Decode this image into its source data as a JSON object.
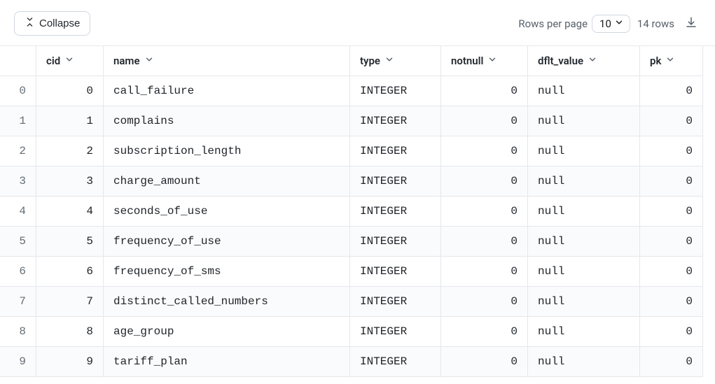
{
  "toolbar": {
    "collapse_label": "Collapse",
    "rows_per_page_label": "Rows per page",
    "rows_per_page_value": "10",
    "total_rows_label": "14 rows"
  },
  "table": {
    "headers": {
      "cid": "cid",
      "name": "name",
      "type": "type",
      "notnull": "notnull",
      "dflt_value": "dflt_value",
      "pk": "pk"
    },
    "rows": [
      {
        "idx": "0",
        "cid": "0",
        "name": "call_failure",
        "type": "INTEGER",
        "notnull": "0",
        "dflt_value": "null",
        "pk": "0"
      },
      {
        "idx": "1",
        "cid": "1",
        "name": "complains",
        "type": "INTEGER",
        "notnull": "0",
        "dflt_value": "null",
        "pk": "0"
      },
      {
        "idx": "2",
        "cid": "2",
        "name": "subscription_length",
        "type": "INTEGER",
        "notnull": "0",
        "dflt_value": "null",
        "pk": "0"
      },
      {
        "idx": "3",
        "cid": "3",
        "name": "charge_amount",
        "type": "INTEGER",
        "notnull": "0",
        "dflt_value": "null",
        "pk": "0"
      },
      {
        "idx": "4",
        "cid": "4",
        "name": "seconds_of_use",
        "type": "INTEGER",
        "notnull": "0",
        "dflt_value": "null",
        "pk": "0"
      },
      {
        "idx": "5",
        "cid": "5",
        "name": "frequency_of_use",
        "type": "INTEGER",
        "notnull": "0",
        "dflt_value": "null",
        "pk": "0"
      },
      {
        "idx": "6",
        "cid": "6",
        "name": "frequency_of_sms",
        "type": "INTEGER",
        "notnull": "0",
        "dflt_value": "null",
        "pk": "0"
      },
      {
        "idx": "7",
        "cid": "7",
        "name": "distinct_called_numbers",
        "type": "INTEGER",
        "notnull": "0",
        "dflt_value": "null",
        "pk": "0"
      },
      {
        "idx": "8",
        "cid": "8",
        "name": "age_group",
        "type": "INTEGER",
        "notnull": "0",
        "dflt_value": "null",
        "pk": "0"
      },
      {
        "idx": "9",
        "cid": "9",
        "name": "tariff_plan",
        "type": "INTEGER",
        "notnull": "0",
        "dflt_value": "null",
        "pk": "0"
      }
    ]
  }
}
